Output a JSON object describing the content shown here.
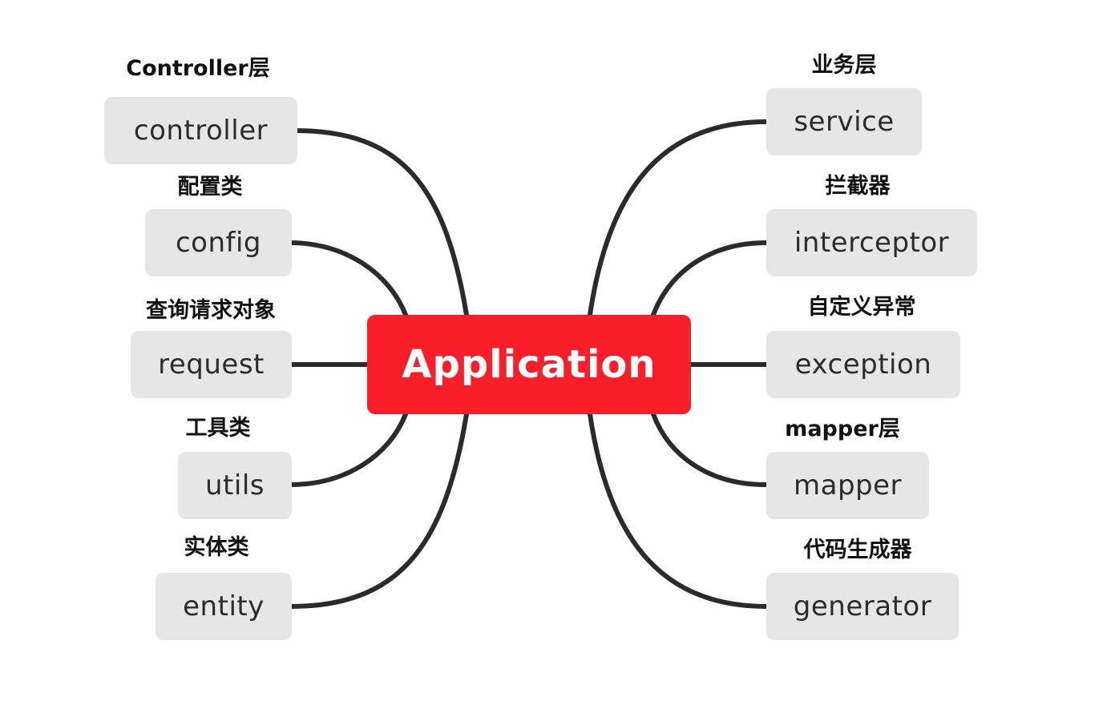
{
  "diagram": {
    "colors": {
      "root_fill": "#fa1e2b",
      "node_fill": "#e6e6e6",
      "connector": "#2b2b2b"
    },
    "root": {
      "label": "Application"
    },
    "left_nodes": [
      {
        "label": "controller",
        "caption": "Controller层"
      },
      {
        "label": "config",
        "caption": "配置类"
      },
      {
        "label": "request",
        "caption": "查询请求对象"
      },
      {
        "label": "utils",
        "caption": "工具类"
      },
      {
        "label": "entity",
        "caption": "实体类"
      }
    ],
    "right_nodes": [
      {
        "label": "service",
        "caption": "业务层"
      },
      {
        "label": "interceptor",
        "caption": "拦截器"
      },
      {
        "label": "exception",
        "caption": "自定义异常"
      },
      {
        "label": "mapper",
        "caption": "mapper层"
      },
      {
        "label": "generator",
        "caption": "代码生成器"
      }
    ]
  }
}
